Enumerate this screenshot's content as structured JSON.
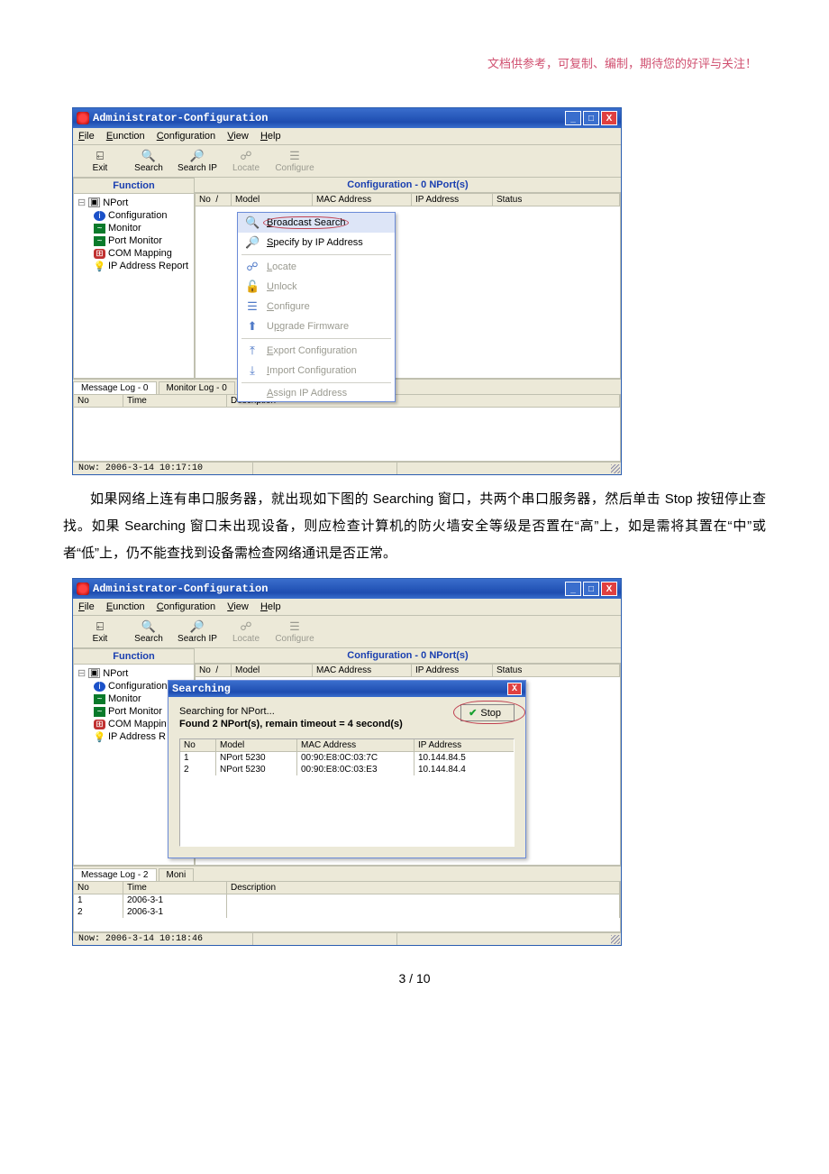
{
  "top_note": "文档供参考，可复制、编制，期待您的好评与关注！",
  "win_title": "Administrator-Configuration",
  "menubar": {
    "file": "File",
    "eunction": "Eunction",
    "configuration": "Configuration",
    "view": "View",
    "help": "Help"
  },
  "toolbar": {
    "exit": "Exit",
    "search": "Search",
    "searchip": "Search IP",
    "locate": "Locate",
    "configure": "Configure"
  },
  "function_hdr": "Function",
  "tree": {
    "root": "NPort",
    "configuration": "Configuration",
    "monitor": "Monitor",
    "port_monitor": "Port Monitor",
    "com_mapping": "COM Mapping",
    "ip_report": "IP Address Report"
  },
  "main_hdr": "Configuration - 0 NPort(s)",
  "list_cols": {
    "no": "No",
    "slash": "/",
    "model": "Model",
    "mac": "MAC Address",
    "ip": "IP Address",
    "status": "Status"
  },
  "context_menu": {
    "broadcast": "Broadcast Search",
    "specify": "Specify by IP Address",
    "locate": "Locate",
    "unlock": "Unlock",
    "configure": "Configure",
    "upgrade": "Upgrade Firmware",
    "export": "Export Configuration",
    "import": "Import Configuration",
    "assign": "Assign IP Address"
  },
  "log_tabs": {
    "msg0": "Message Log - 0",
    "mon0": "Monitor Log - 0",
    "msg2": "Message Log - 2",
    "mon1": "Moni"
  },
  "log_cols": {
    "no": "No",
    "time": "Time",
    "desc": "Description"
  },
  "status1": "Now: 2006-3-14 10:17:10",
  "status2": "Now: 2006-3-14 10:18:46",
  "body_paragraph": "如果网络上连有串口服务器，就出现如下图的 Searching 窗口，共两个串口服务器，然后单击 Stop 按钮停止查找。如果 Searching 窗口未出现设备，则应检查计算机的防火墙安全等级是否置在“高”上，如是需将其置在“中”或者“低”上，仍不能查找到设备需检查网络通讯是否正常。",
  "dialog": {
    "title": "Searching",
    "msg1": "Searching for NPort...",
    "msg2": "Found 2 NPort(s), remain timeout = 4 second(s)",
    "stop": "Stop",
    "rows": [
      {
        "no": "1",
        "model": "NPort 5230",
        "mac": "00:90:E8:0C:03:7C",
        "ip": "10.144.84.5"
      },
      {
        "no": "2",
        "model": "NPort 5230",
        "mac": "00:90:E8:0C:03:E3",
        "ip": "10.144.84.4"
      }
    ]
  },
  "log_rows2": [
    {
      "no": "1",
      "time": "2006-3-1"
    },
    {
      "no": "2",
      "time": "2006-3-1"
    }
  ],
  "page_num": "3 / 10"
}
